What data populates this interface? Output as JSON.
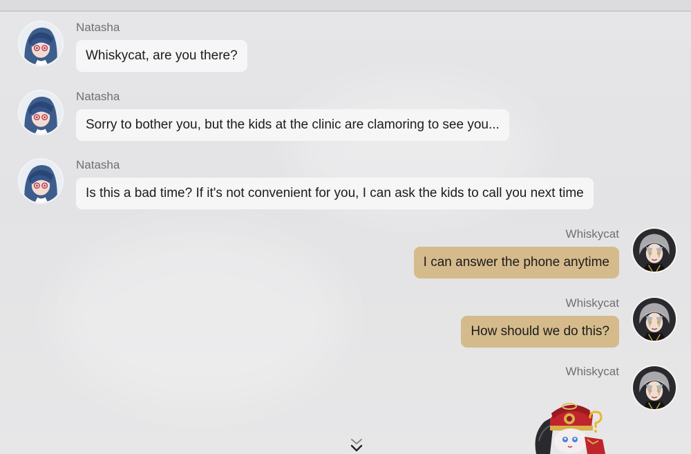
{
  "chat": {
    "messages": [
      {
        "sender": "Natasha",
        "side": "left",
        "text": "Whiskycat, are you there?",
        "avatar_icon": "natasha-avatar-icon"
      },
      {
        "sender": "Natasha",
        "side": "left",
        "text": "Sorry to bother you, but the kids at the clinic are clamoring to see you...",
        "avatar_icon": "natasha-avatar-icon"
      },
      {
        "sender": "Natasha",
        "side": "left",
        "text": "Is this a bad time? If it's not convenient for you, I can ask the kids to call you next time",
        "avatar_icon": "natasha-avatar-icon"
      },
      {
        "sender": "Whiskycat",
        "side": "right",
        "text": "I can answer the phone anytime",
        "avatar_icon": "whiskycat-avatar-icon"
      },
      {
        "sender": "Whiskycat",
        "side": "right",
        "text": "How should we do this?",
        "avatar_icon": "whiskycat-avatar-icon"
      },
      {
        "sender": "Whiskycat",
        "side": "right",
        "sticker_icon": "confused-character-sticker-icon",
        "avatar_icon": "whiskycat-avatar-icon"
      }
    ],
    "scroll_down_icon": "double-chevron-down-icon"
  },
  "colors": {
    "background": "#e4e4e6",
    "incoming_bubble": "#f6f6f7",
    "outgoing_bubble": "#d5bb8b",
    "name_text": "#6f6f74",
    "message_text": "#1b1b1d"
  }
}
